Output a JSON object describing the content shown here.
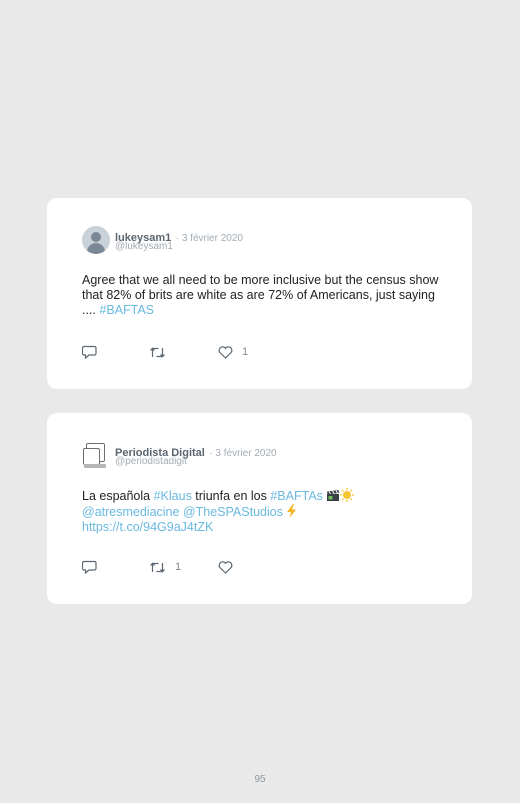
{
  "tweets": [
    {
      "name": "lukeysam1",
      "date": "· 3 février 2020",
      "handle": "@lukeysam1",
      "text_plain": "Agree that we all need to be more inclusive but the census show that 82% of brits are white as are 72% of Americans, just saying .... ",
      "hashtag": "#BAFTAS",
      "reply_count": "",
      "retweet_count": "",
      "like_count": "1"
    },
    {
      "name": "Periodista Digital",
      "date": "· 3 février 2020",
      "handle": "@periodistadigit",
      "text_1": "La española ",
      "hashtag_1": "#Klaus",
      "text_2": " triunfa en los ",
      "hashtag_2": "#BAFTAs",
      "mention_1": "@atresmediacine",
      "mention_2": "@TheSPAStudios",
      "url": "https://t.co/94G9aJ4tZK",
      "reply_count": "",
      "retweet_count": "1",
      "like_count": ""
    }
  ],
  "page_number": "95",
  "colors": {
    "link": "#6ab9e0",
    "background": "#e9e9e9",
    "card": "#ffffff"
  },
  "icons": [
    "reply-icon",
    "retweet-icon",
    "like-icon",
    "clapper-icon",
    "sun-icon",
    "lightning-icon"
  ]
}
